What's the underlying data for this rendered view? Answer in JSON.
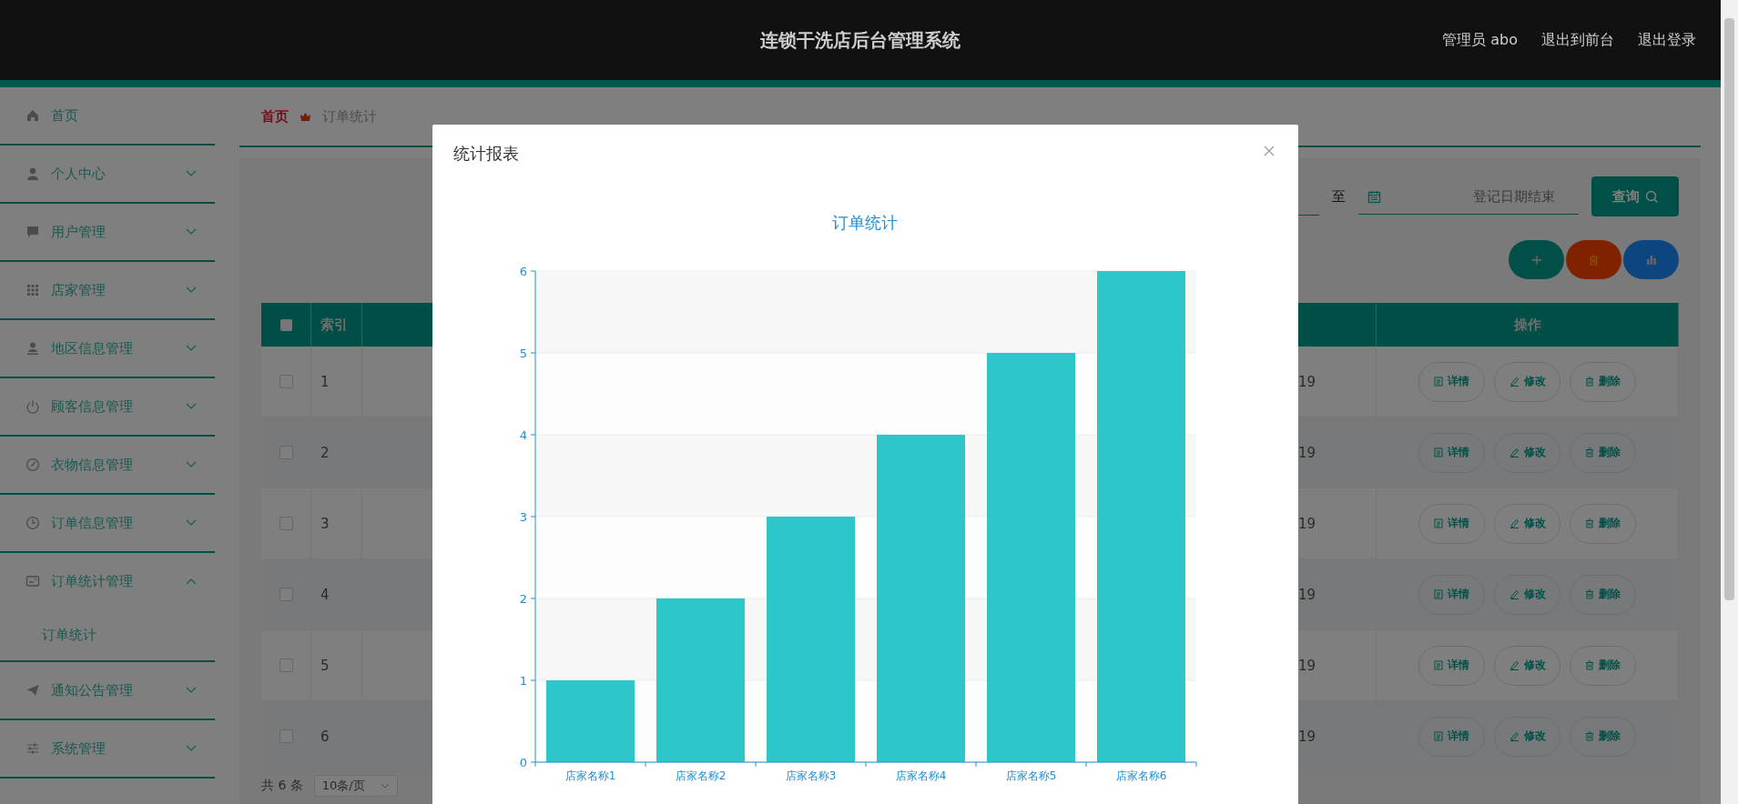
{
  "header": {
    "title": "连锁干洗店后台管理系统",
    "links": [
      "管理员 abo",
      "退出到前台",
      "退出登录"
    ]
  },
  "sidebar": {
    "items": [
      {
        "label": "首页",
        "kind": "link"
      },
      {
        "label": "个人中心",
        "kind": "menu",
        "expanded": false
      },
      {
        "label": "用户管理",
        "kind": "menu",
        "expanded": false
      },
      {
        "label": "店家管理",
        "kind": "menu",
        "expanded": false
      },
      {
        "label": "地区信息管理",
        "kind": "menu",
        "expanded": false
      },
      {
        "label": "顾客信息管理",
        "kind": "menu",
        "expanded": false
      },
      {
        "label": "衣物信息管理",
        "kind": "menu",
        "expanded": false
      },
      {
        "label": "订单信息管理",
        "kind": "menu",
        "expanded": false
      },
      {
        "label": "订单统计管理",
        "kind": "menu",
        "expanded": true,
        "children": [
          {
            "label": "订单统计"
          }
        ]
      },
      {
        "label": "通知公告管理",
        "kind": "menu",
        "expanded": false
      },
      {
        "label": "系统管理",
        "kind": "menu",
        "expanded": false
      }
    ]
  },
  "breadcrumb": {
    "items": [
      "首页",
      "订单统计"
    ]
  },
  "search": {
    "separator": "至",
    "end_placeholder": "登记日期结束",
    "button": "查询"
  },
  "table": {
    "select_all_checked": false,
    "columns": {
      "index": "索引",
      "operations": "操作"
    },
    "rows": [
      {
        "checked": false,
        "index": "1",
        "column_4": "19",
        "actions": [
          "详情",
          "修改",
          "删除"
        ]
      },
      {
        "checked": false,
        "index": "2",
        "column_4": "19",
        "actions": [
          "详情",
          "修改",
          "删除"
        ]
      },
      {
        "checked": false,
        "index": "3",
        "column_4": "19",
        "actions": [
          "详情",
          "修改",
          "删除"
        ]
      },
      {
        "checked": false,
        "index": "4",
        "column_4": "19",
        "actions": [
          "详情",
          "修改",
          "删除"
        ]
      },
      {
        "checked": false,
        "index": "5",
        "column_4": "19",
        "actions": [
          "详情",
          "修改",
          "删除"
        ]
      },
      {
        "checked": false,
        "index": "6",
        "column_4": "19",
        "actions": [
          "详情",
          "修改",
          "删除"
        ]
      }
    ]
  },
  "pagination": {
    "total": "共 6 条",
    "page_size": "10条/页"
  },
  "modal": {
    "title": "统计报表",
    "chart_data": {
      "type": "bar",
      "title": "订单统计",
      "categories": [
        "店家名称1",
        "店家名称2",
        "店家名称3",
        "店家名称4",
        "店家名称5",
        "店家名称6"
      ],
      "values": [
        1,
        2,
        3,
        4,
        5,
        6
      ],
      "ylim": [
        0,
        6
      ],
      "yticks": [
        0,
        1,
        2,
        3,
        4,
        5,
        6
      ],
      "grid": true
    }
  }
}
